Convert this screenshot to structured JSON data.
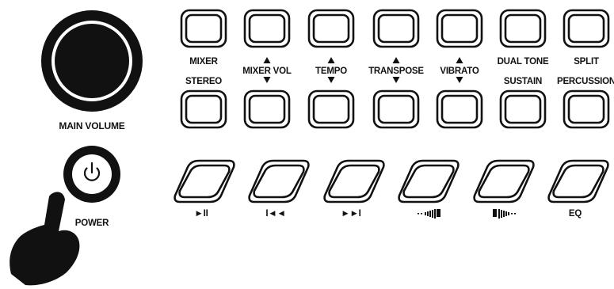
{
  "main_volume": {
    "label": "MAIN VOLUME"
  },
  "power": {
    "label": "POWER",
    "icon": "power-icon"
  },
  "top_row": [
    {
      "top": "MIXER",
      "bottom": "STEREO",
      "arrow_top": false,
      "arrow_bottom": false
    },
    {
      "top": "MIXER VOL",
      "bottom": "",
      "arrow_top": true,
      "arrow_bottom": true
    },
    {
      "top": "TEMPO",
      "bottom": "",
      "arrow_top": true,
      "arrow_bottom": true
    },
    {
      "top": "TRANSPOSE",
      "bottom": "",
      "arrow_top": true,
      "arrow_bottom": true
    },
    {
      "top": "VIBRATO",
      "bottom": "",
      "arrow_top": true,
      "arrow_bottom": true
    },
    {
      "top": "DUAL TONE",
      "bottom": "SUSTAIN",
      "arrow_top": false,
      "arrow_bottom": false
    },
    {
      "top": "SPLIT",
      "bottom": "PERCUSSION",
      "arrow_top": false,
      "arrow_bottom": false
    }
  ],
  "transport": [
    {
      "label": "►II",
      "icon": "play-pause-icon"
    },
    {
      "label": "I◄◄",
      "icon": "previous-icon"
    },
    {
      "label": "►►I",
      "icon": "next-icon"
    },
    {
      "label": "",
      "icon": "volume-down-icon"
    },
    {
      "label": "",
      "icon": "volume-up-icon"
    },
    {
      "label": "EQ",
      "icon": ""
    }
  ]
}
